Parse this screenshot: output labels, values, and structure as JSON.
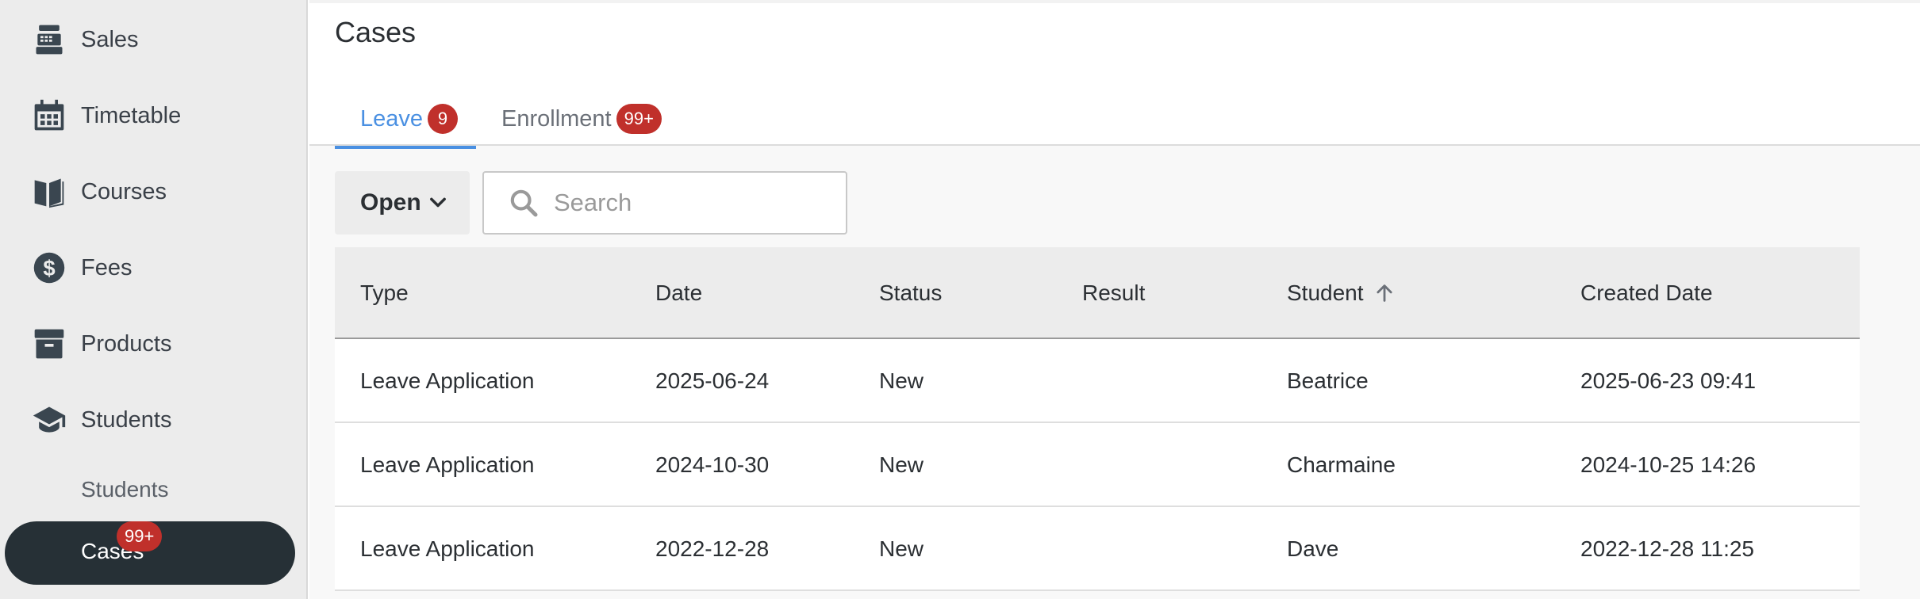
{
  "sidebar": {
    "items": [
      {
        "label": "Sales",
        "icon": "cash-register-icon"
      },
      {
        "label": "Timetable",
        "icon": "calendar-icon"
      },
      {
        "label": "Courses",
        "icon": "book-open-icon"
      },
      {
        "label": "Fees",
        "icon": "dollar-circle-icon"
      },
      {
        "label": "Products",
        "icon": "archive-box-icon"
      },
      {
        "label": "Students",
        "icon": "graduation-cap-icon"
      }
    ],
    "subitems": [
      {
        "label": "Students"
      },
      {
        "label": "Cases",
        "badge": "99+",
        "active": true
      }
    ]
  },
  "header": {
    "title": "Cases",
    "tabs": [
      {
        "label": "Leave",
        "badge": "9",
        "active": true
      },
      {
        "label": "Enrollment",
        "badge": "99+",
        "active": false
      }
    ]
  },
  "toolbar": {
    "filter_label": "Open",
    "search_placeholder": "Search",
    "search_value": ""
  },
  "table": {
    "columns": [
      "Type",
      "Date",
      "Status",
      "Result",
      "Student",
      "Created Date"
    ],
    "sort": {
      "column": "Student",
      "direction": "asc"
    },
    "rows": [
      {
        "type": "Leave Application",
        "date": "2025-06-24",
        "status": "New",
        "result": "",
        "student": "Beatrice",
        "created": "2025-06-23 09:41"
      },
      {
        "type": "Leave Application",
        "date": "2024-10-30",
        "status": "New",
        "result": "",
        "student": "Charmaine",
        "created": "2024-10-25 14:26"
      },
      {
        "type": "Leave Application",
        "date": "2022-12-28",
        "status": "New",
        "result": "",
        "student": "Dave",
        "created": "2022-12-28 11:25"
      }
    ]
  },
  "colors": {
    "accent": "#4a90e2",
    "badge": "#c0302b",
    "active_nav": "#263036"
  }
}
